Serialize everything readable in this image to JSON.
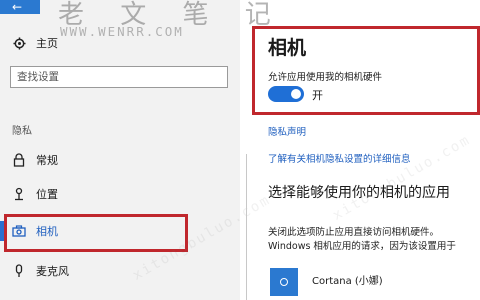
{
  "watermark": {
    "site_name": "老 文 笔 记",
    "site_url": "WWW.WENRR.COM",
    "diagonal_text": "xitongbuluo.com"
  },
  "sidebar": {
    "home_label": "主页",
    "search_placeholder": "查找设置",
    "section_title": "隐私",
    "items": [
      {
        "label": "常规",
        "icon": "lock-icon"
      },
      {
        "label": "位置",
        "icon": "location-icon"
      },
      {
        "label": "相机",
        "icon": "camera-icon",
        "active": true
      },
      {
        "label": "麦克风",
        "icon": "microphone-icon"
      }
    ]
  },
  "main": {
    "title": "相机",
    "permission_label": "允许应用使用我的相机硬件",
    "toggle_state": "开",
    "privacy_link": "隐私声明",
    "learn_more_link": "了解有关相机隐私设置的详细信息",
    "section_heading": "选择能够使用你的相机的应用",
    "description_line1": "关闭此选项防止应用直接访问相机硬件。",
    "description_line2": "Windows 相机应用的请求，因为该设置用于",
    "apps": [
      {
        "name": "Cortana (小娜)"
      }
    ]
  },
  "colors": {
    "accent": "#1f6fd6",
    "highlight_box": "#c0272d",
    "sidebar_bg": "#f2f2f2"
  }
}
